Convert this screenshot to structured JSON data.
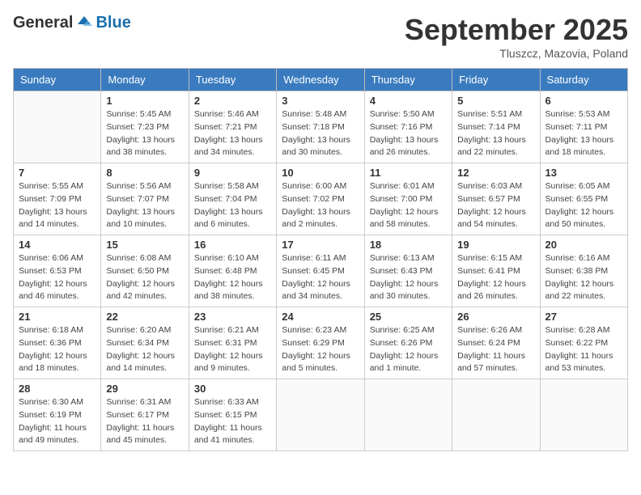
{
  "logo": {
    "general": "General",
    "blue": "Blue"
  },
  "header": {
    "month": "September 2025",
    "location": "Tluszcz, Mazovia, Poland"
  },
  "weekdays": [
    "Sunday",
    "Monday",
    "Tuesday",
    "Wednesday",
    "Thursday",
    "Friday",
    "Saturday"
  ],
  "weeks": [
    [
      {
        "day": null,
        "info": ""
      },
      {
        "day": "1",
        "info": "Sunrise: 5:45 AM\nSunset: 7:23 PM\nDaylight: 13 hours\nand 38 minutes."
      },
      {
        "day": "2",
        "info": "Sunrise: 5:46 AM\nSunset: 7:21 PM\nDaylight: 13 hours\nand 34 minutes."
      },
      {
        "day": "3",
        "info": "Sunrise: 5:48 AM\nSunset: 7:18 PM\nDaylight: 13 hours\nand 30 minutes."
      },
      {
        "day": "4",
        "info": "Sunrise: 5:50 AM\nSunset: 7:16 PM\nDaylight: 13 hours\nand 26 minutes."
      },
      {
        "day": "5",
        "info": "Sunrise: 5:51 AM\nSunset: 7:14 PM\nDaylight: 13 hours\nand 22 minutes."
      },
      {
        "day": "6",
        "info": "Sunrise: 5:53 AM\nSunset: 7:11 PM\nDaylight: 13 hours\nand 18 minutes."
      }
    ],
    [
      {
        "day": "7",
        "info": "Sunrise: 5:55 AM\nSunset: 7:09 PM\nDaylight: 13 hours\nand 14 minutes."
      },
      {
        "day": "8",
        "info": "Sunrise: 5:56 AM\nSunset: 7:07 PM\nDaylight: 13 hours\nand 10 minutes."
      },
      {
        "day": "9",
        "info": "Sunrise: 5:58 AM\nSunset: 7:04 PM\nDaylight: 13 hours\nand 6 minutes."
      },
      {
        "day": "10",
        "info": "Sunrise: 6:00 AM\nSunset: 7:02 PM\nDaylight: 13 hours\nand 2 minutes."
      },
      {
        "day": "11",
        "info": "Sunrise: 6:01 AM\nSunset: 7:00 PM\nDaylight: 12 hours\nand 58 minutes."
      },
      {
        "day": "12",
        "info": "Sunrise: 6:03 AM\nSunset: 6:57 PM\nDaylight: 12 hours\nand 54 minutes."
      },
      {
        "day": "13",
        "info": "Sunrise: 6:05 AM\nSunset: 6:55 PM\nDaylight: 12 hours\nand 50 minutes."
      }
    ],
    [
      {
        "day": "14",
        "info": "Sunrise: 6:06 AM\nSunset: 6:53 PM\nDaylight: 12 hours\nand 46 minutes."
      },
      {
        "day": "15",
        "info": "Sunrise: 6:08 AM\nSunset: 6:50 PM\nDaylight: 12 hours\nand 42 minutes."
      },
      {
        "day": "16",
        "info": "Sunrise: 6:10 AM\nSunset: 6:48 PM\nDaylight: 12 hours\nand 38 minutes."
      },
      {
        "day": "17",
        "info": "Sunrise: 6:11 AM\nSunset: 6:45 PM\nDaylight: 12 hours\nand 34 minutes."
      },
      {
        "day": "18",
        "info": "Sunrise: 6:13 AM\nSunset: 6:43 PM\nDaylight: 12 hours\nand 30 minutes."
      },
      {
        "day": "19",
        "info": "Sunrise: 6:15 AM\nSunset: 6:41 PM\nDaylight: 12 hours\nand 26 minutes."
      },
      {
        "day": "20",
        "info": "Sunrise: 6:16 AM\nSunset: 6:38 PM\nDaylight: 12 hours\nand 22 minutes."
      }
    ],
    [
      {
        "day": "21",
        "info": "Sunrise: 6:18 AM\nSunset: 6:36 PM\nDaylight: 12 hours\nand 18 minutes."
      },
      {
        "day": "22",
        "info": "Sunrise: 6:20 AM\nSunset: 6:34 PM\nDaylight: 12 hours\nand 14 minutes."
      },
      {
        "day": "23",
        "info": "Sunrise: 6:21 AM\nSunset: 6:31 PM\nDaylight: 12 hours\nand 9 minutes."
      },
      {
        "day": "24",
        "info": "Sunrise: 6:23 AM\nSunset: 6:29 PM\nDaylight: 12 hours\nand 5 minutes."
      },
      {
        "day": "25",
        "info": "Sunrise: 6:25 AM\nSunset: 6:26 PM\nDaylight: 12 hours\nand 1 minute."
      },
      {
        "day": "26",
        "info": "Sunrise: 6:26 AM\nSunset: 6:24 PM\nDaylight: 11 hours\nand 57 minutes."
      },
      {
        "day": "27",
        "info": "Sunrise: 6:28 AM\nSunset: 6:22 PM\nDaylight: 11 hours\nand 53 minutes."
      }
    ],
    [
      {
        "day": "28",
        "info": "Sunrise: 6:30 AM\nSunset: 6:19 PM\nDaylight: 11 hours\nand 49 minutes."
      },
      {
        "day": "29",
        "info": "Sunrise: 6:31 AM\nSunset: 6:17 PM\nDaylight: 11 hours\nand 45 minutes."
      },
      {
        "day": "30",
        "info": "Sunrise: 6:33 AM\nSunset: 6:15 PM\nDaylight: 11 hours\nand 41 minutes."
      },
      {
        "day": null,
        "info": ""
      },
      {
        "day": null,
        "info": ""
      },
      {
        "day": null,
        "info": ""
      },
      {
        "day": null,
        "info": ""
      }
    ]
  ]
}
